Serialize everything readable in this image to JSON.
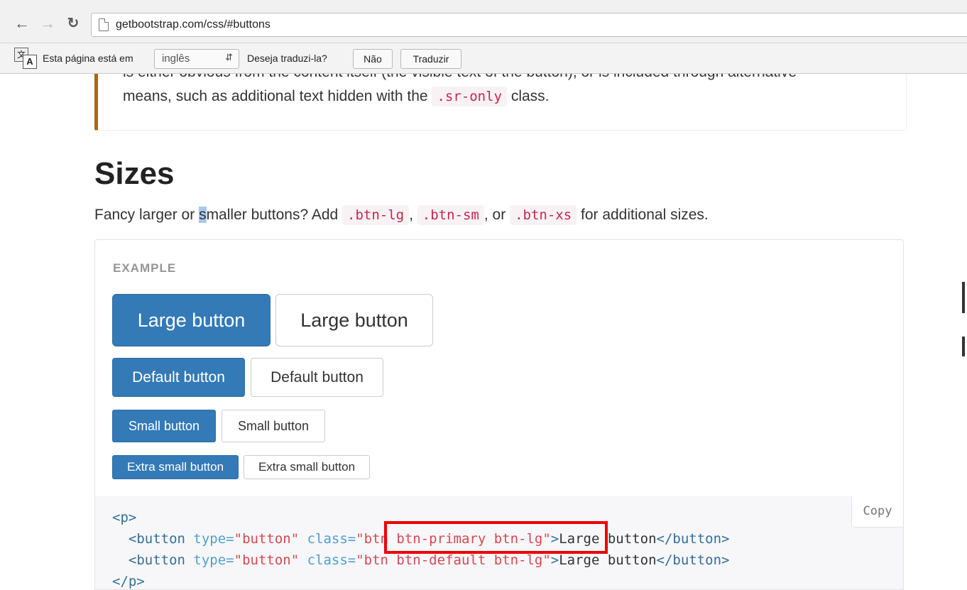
{
  "browser": {
    "url": "getbootstrap.com/css/#buttons"
  },
  "translate_bar": {
    "prefix": "Esta página está em",
    "language": "inglês",
    "question": "Deseja traduzi-la?",
    "no_label": "Não",
    "translate_label": "Traduzir",
    "icon_back_glyph": "文",
    "icon_front_glyph": "A"
  },
  "callout": {
    "cut_line": "is either obvious from the content itself (the visible text of the button), or is included through alternative",
    "line2_before": "means, such as additional text hidden with the",
    "line2_code": ".sr-only",
    "line2_after": "class."
  },
  "section": {
    "title": "Sizes",
    "lead_a": "Fancy larger or ",
    "lead_sel": "s",
    "lead_b": "maller buttons? Add",
    "code1": ".btn-lg",
    "sep1": ",",
    "code2": ".btn-sm",
    "sep2": ", or",
    "code3": ".btn-xs",
    "lead_end": "for additional sizes."
  },
  "example": {
    "label": "EXAMPLE",
    "large_primary": "Large button",
    "large_default": "Large button",
    "default_primary": "Default button",
    "default_default": "Default button",
    "small_primary": "Small button",
    "small_default": "Small button",
    "xs_primary": "Extra small button",
    "xs_default": "Extra small button"
  },
  "code": {
    "copy_label": "Copy",
    "p_open": "<p>",
    "p_close": "</p>",
    "btn_open": "<button",
    "type_attr": "type=",
    "type_val": "\"button\"",
    "class_attr": "class=",
    "class_val1": "\"btn btn-primary btn-lg\"",
    "class_val2": "\"btn btn-default btn-lg\"",
    "gt": ">",
    "content": "Large button",
    "btn_close": "</button>",
    "gt2": ">"
  },
  "colors": {
    "primary": "#337ab7",
    "warning_border": "#aa6708",
    "code_text": "#c7254e",
    "highlight_box": "#e00000"
  }
}
